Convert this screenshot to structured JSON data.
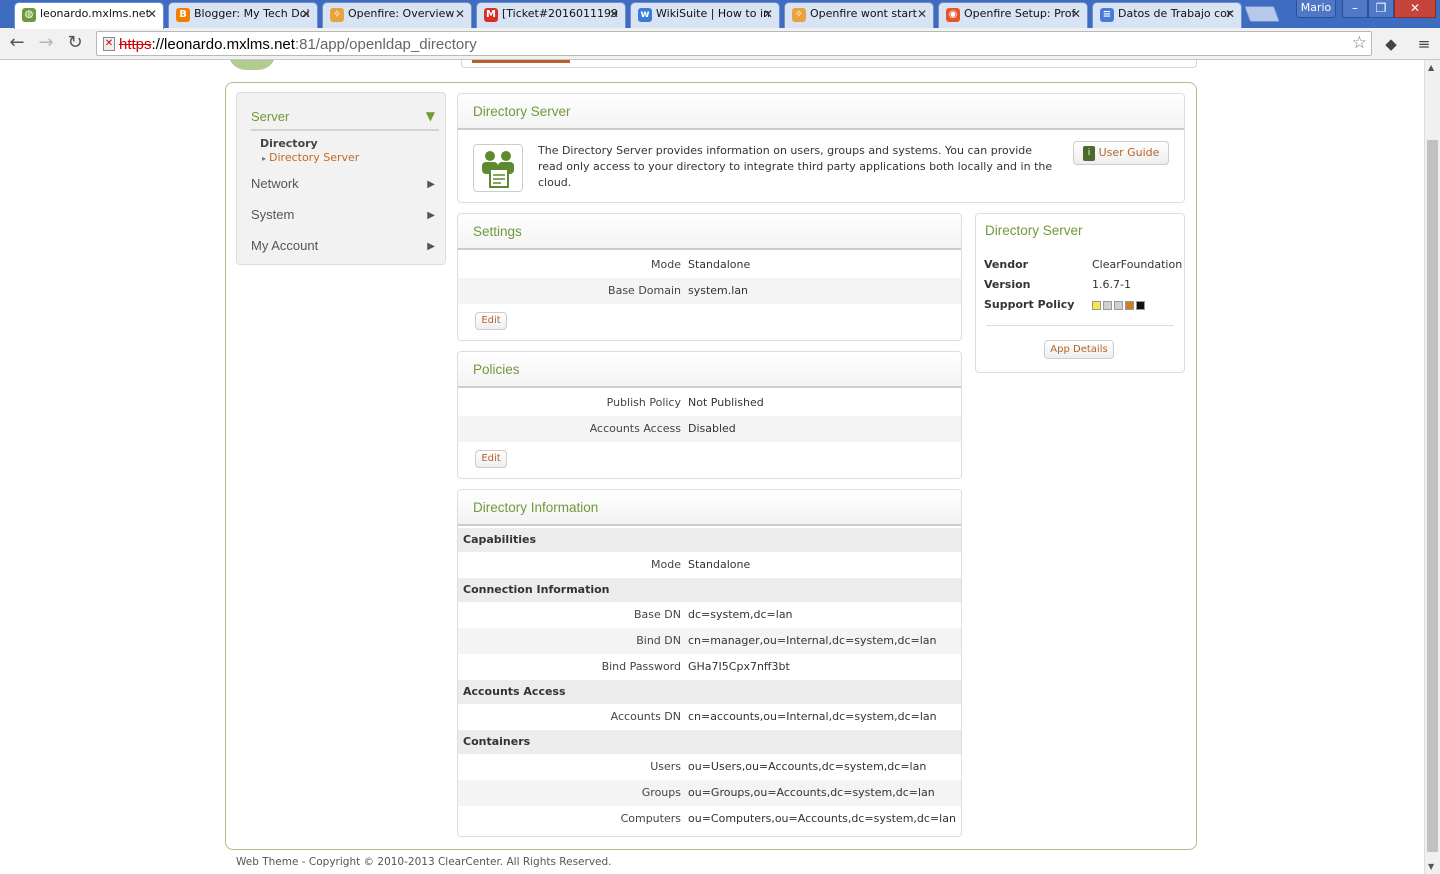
{
  "browser": {
    "tabs": [
      {
        "title": "leonardo.mxlms.net",
        "icon_color": "#6f9a3a",
        "active": true
      },
      {
        "title": "Blogger: My Tech Doi",
        "icon_color": "#f57d00",
        "active": false
      },
      {
        "title": "Openfire: Overview",
        "icon_color": "#e8a33d",
        "active": false
      },
      {
        "title": "[Ticket#2016011199",
        "icon_color": "#d93025",
        "active": false
      },
      {
        "title": "WikiSuite | How to in",
        "icon_color": "#3a7bd5",
        "active": false
      },
      {
        "title": "Openfire wont start",
        "icon_color": "#e8a33d",
        "active": false
      },
      {
        "title": "Openfire Setup: Prof",
        "icon_color": "#e8542a",
        "active": false
      },
      {
        "title": "Datos de Trabajo cor",
        "icon_color": "#4a7bd8",
        "active": false
      }
    ],
    "user_label": "Mario",
    "url_scheme": "https",
    "url_host": "://leonardo.mxlms.net",
    "url_path": ":81/app/openldap_directory"
  },
  "sidebar": {
    "server_label": "Server",
    "directory_heading": "Directory",
    "directory_link": "Directory Server",
    "network_label": "Network",
    "system_label": "System",
    "account_label": "My Account"
  },
  "intro": {
    "title": "Directory Server",
    "text": "The Directory Server provides information on users, groups and systems. You can provide read only access to your directory to integrate third party applications both locally and in the cloud.",
    "guide_label": "User Guide"
  },
  "settings": {
    "title": "Settings",
    "mode_label": "Mode",
    "mode_value": "Standalone",
    "domain_label": "Base Domain",
    "domain_value": "system.lan",
    "edit_label": "Edit"
  },
  "policies": {
    "title": "Policies",
    "publish_label": "Publish Policy",
    "publish_value": "Not Published",
    "access_label": "Accounts Access",
    "access_value": "Disabled",
    "edit_label": "Edit"
  },
  "info": {
    "title": "Directory Information",
    "capabilities": "Capabilities",
    "mode_label": "Mode",
    "mode_value": "Standalone",
    "connection": "Connection Information",
    "base_dn_label": "Base DN",
    "base_dn_value": "dc=system,dc=lan",
    "bind_dn_label": "Bind DN",
    "bind_dn_value": "cn=manager,ou=Internal,dc=system,dc=lan",
    "bind_pw_label": "Bind Password",
    "bind_pw_value": "GHa7I5Cpx7nff3bt",
    "accounts_access": "Accounts Access",
    "accounts_dn_label": "Accounts DN",
    "accounts_dn_value": "cn=accounts,ou=Internal,dc=system,dc=lan",
    "containers": "Containers",
    "users_label": "Users",
    "users_value": "ou=Users,ou=Accounts,dc=system,dc=lan",
    "groups_label": "Groups",
    "groups_value": "ou=Groups,ou=Accounts,dc=system,dc=lan",
    "computers_label": "Computers",
    "computers_value": "ou=Computers,ou=Accounts,dc=system,dc=lan"
  },
  "app_info": {
    "title": "Directory Server",
    "vendor_label": "Vendor",
    "vendor_value": "ClearFoundation",
    "version_label": "Version",
    "version_value": "1.6.7-1",
    "support_label": "Support Policy",
    "support_colors": [
      "#f5e94a",
      "#d0d0d0",
      "#d0d0d0",
      "#d07a2a",
      "#111111"
    ],
    "details_label": "App Details"
  },
  "footer": "Web Theme - Copyright © 2010-2013 ClearCenter. All Rights Reserved.",
  "colors": {
    "accent_green": "#6f9a3a",
    "accent_orange": "#b6622a"
  }
}
